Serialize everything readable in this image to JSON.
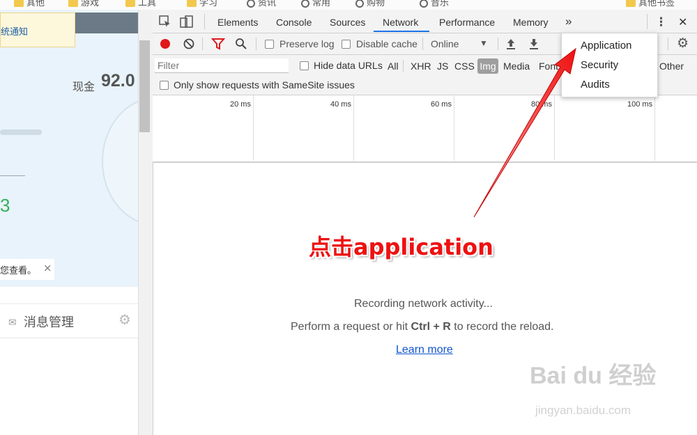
{
  "bookmarks": [
    {
      "label": "其他",
      "icon": "folder-icon"
    },
    {
      "label": "游戏",
      "icon": "folder-icon"
    },
    {
      "label": "工具",
      "icon": "folder-icon"
    },
    {
      "label": "学习",
      "icon": "folder-icon"
    },
    {
      "label": "资讯",
      "icon": "globe-icon"
    },
    {
      "label": "常用",
      "icon": "globe-icon"
    },
    {
      "label": "购物",
      "icon": "globe-icon"
    },
    {
      "label": "音乐",
      "icon": "globe-icon"
    },
    {
      "label": "其他书签",
      "icon": "folder-icon"
    }
  ],
  "left_page": {
    "notice": "统通知",
    "cash_label": "现金",
    "cash_value": "92.0",
    "green_value": "3",
    "tip_text": "您查看。",
    "tip_close": "×",
    "message_label": "消息管理"
  },
  "devtools": {
    "tabs": [
      "Elements",
      "Console",
      "Sources",
      "Network",
      "Performance",
      "Memory"
    ],
    "active_tab": "Network",
    "more_tabs": "»",
    "close": "✕",
    "toolbar": {
      "preserve_log": "Preserve log",
      "disable_cache": "Disable cache",
      "throttling": "Online"
    },
    "filter": {
      "placeholder": "Filter",
      "hide_data_urls": "Hide data URLs",
      "types": [
        "All",
        "XHR",
        "JS",
        "CSS",
        "Img",
        "Media",
        "Font",
        "Other"
      ],
      "selected_type": "Img",
      "samesite": "Only show requests with SameSite issues"
    },
    "timeline_ticks": [
      "20 ms",
      "40 ms",
      "60 ms",
      "80 ms",
      "100 ms"
    ],
    "empty": {
      "line1": "Recording network activity...",
      "line2_pre": "Perform a request or hit ",
      "line2_key": "Ctrl + R",
      "line2_post": " to record the reload.",
      "learn_more": "Learn more"
    },
    "overflow_menu": [
      "Application",
      "Security",
      "Audits"
    ]
  },
  "annotation": "点击application",
  "watermark": {
    "main": "Bai du 经验",
    "sub": "jingyan.baidu.com"
  },
  "colors": {
    "record_red": "#e0191a",
    "annotation_red": "#ee1111",
    "link_blue": "#1155cc",
    "tab_underline": "#1a73e8"
  }
}
